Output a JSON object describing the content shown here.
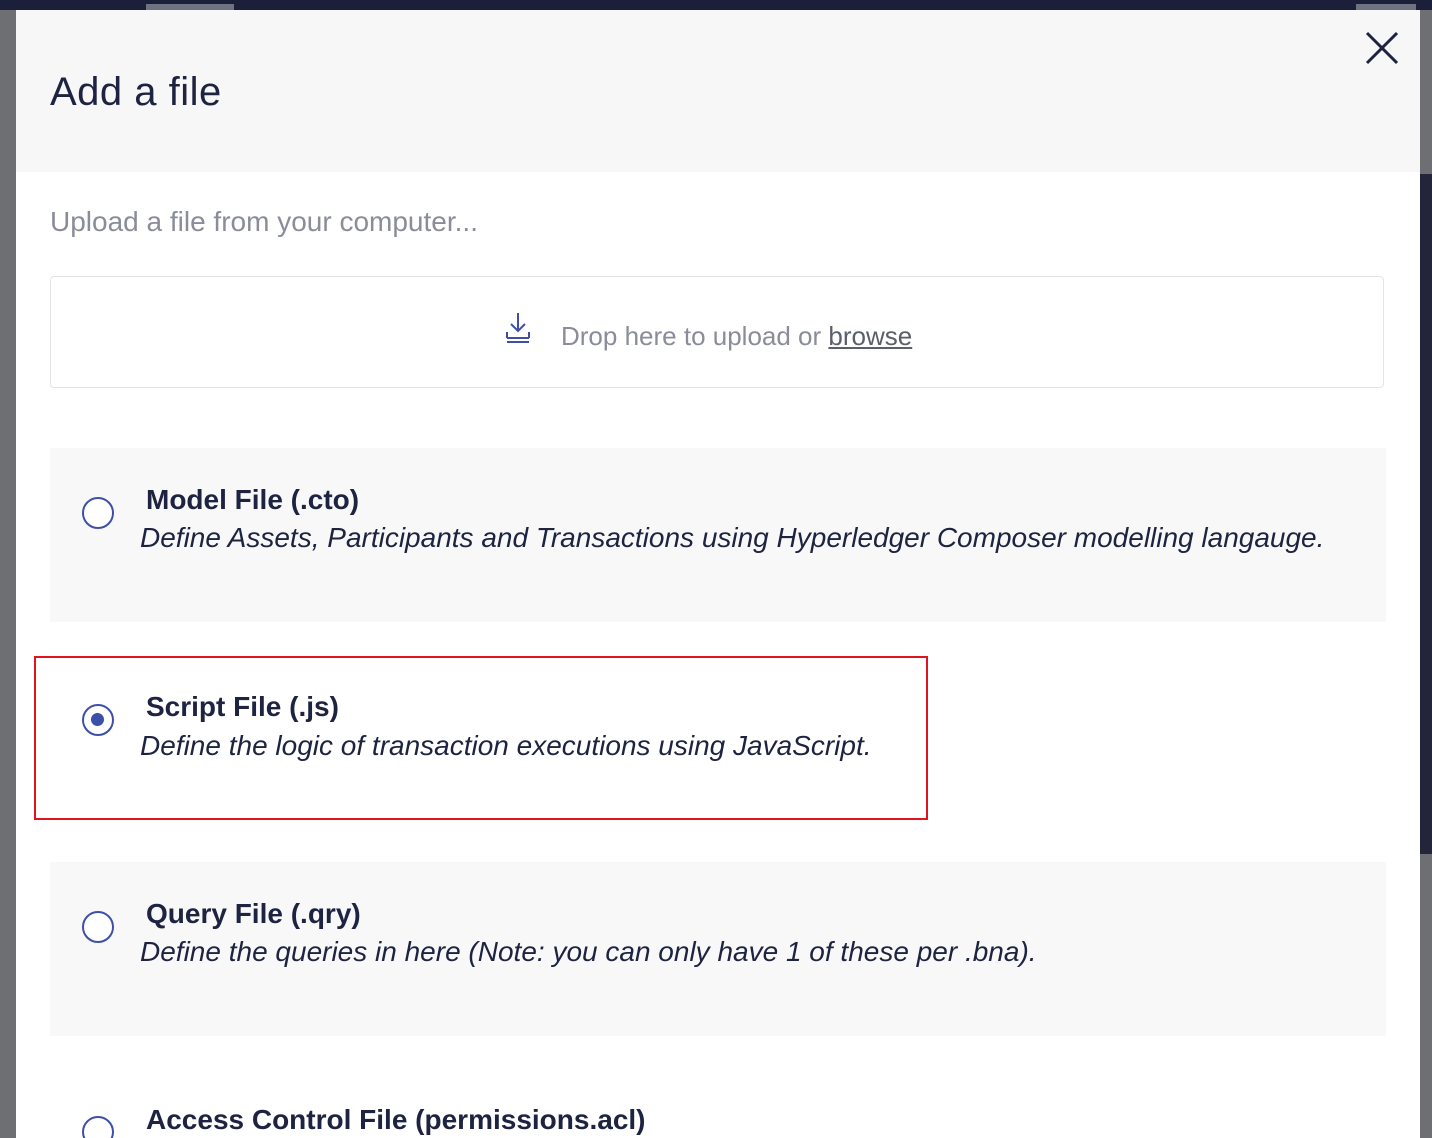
{
  "modal": {
    "title": "Add a file",
    "close_icon": "close-icon"
  },
  "upload": {
    "heading": "Upload a file from your computer...",
    "drop_text": "Drop here to upload or",
    "browse_label": "browse",
    "icon": "upload-icon"
  },
  "options": [
    {
      "title": "Model File (.cto)",
      "description": "Define Assets, Participants and Transactions using Hyperledger Composer modelling langauge.",
      "selected": false
    },
    {
      "title": "Script File (.js)",
      "description": "Define the logic of transaction executions using JavaScript.",
      "selected": true
    },
    {
      "title": "Query File (.qry)",
      "description": "Define the queries in here (Note: you can only have 1 of these per .bna).",
      "selected": false
    },
    {
      "title": "Access Control File (permissions.acl)",
      "description": "",
      "selected": false
    }
  ],
  "colors": {
    "accent": "#3d4fa8",
    "highlight": "#e0141e",
    "text": "#1d2340",
    "muted": "#8a8d99"
  }
}
